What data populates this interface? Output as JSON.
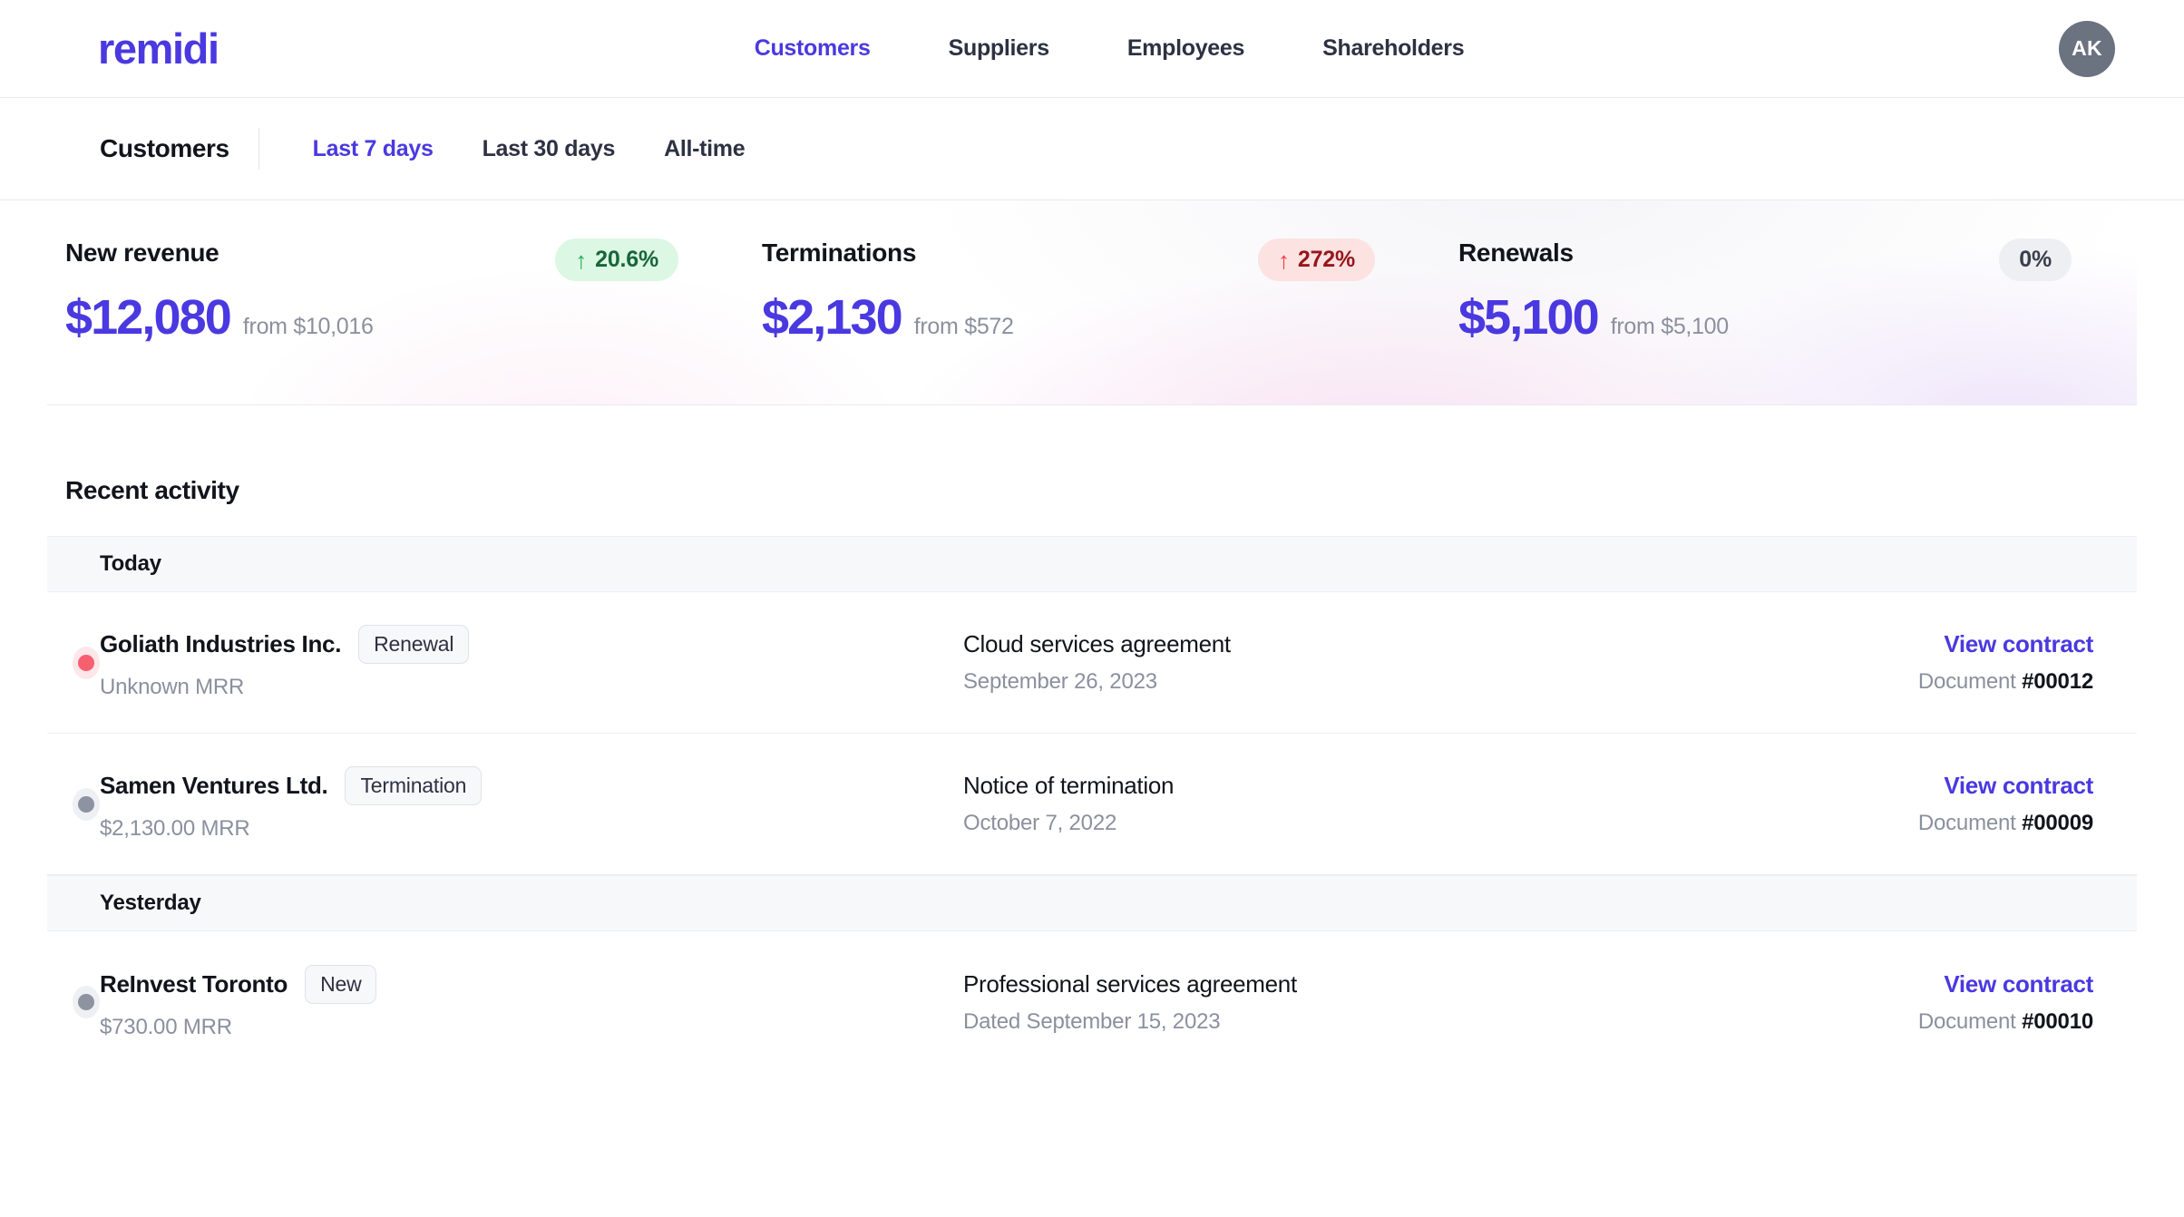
{
  "brand": {
    "logo_text": "remidi"
  },
  "topnav": {
    "items": [
      {
        "label": "Customers",
        "active": true
      },
      {
        "label": "Suppliers",
        "active": false
      },
      {
        "label": "Employees",
        "active": false
      },
      {
        "label": "Shareholders",
        "active": false
      }
    ],
    "avatar_initials": "AK"
  },
  "subheader": {
    "title": "Customers",
    "range_tabs": [
      {
        "label": "Last 7 days",
        "active": true
      },
      {
        "label": "Last 30 days",
        "active": false
      },
      {
        "label": "All-time",
        "active": false
      }
    ]
  },
  "metrics": [
    {
      "label": "New revenue",
      "amount": "$12,080",
      "from": "from $10,016",
      "badge": {
        "text": "20.6%",
        "arrow": "↑",
        "direction": "up"
      }
    },
    {
      "label": "Terminations",
      "amount": "$2,130",
      "from": "from $572",
      "badge": {
        "text": "272%",
        "arrow": "↑",
        "direction": "down"
      }
    },
    {
      "label": "Renewals",
      "amount": "$5,100",
      "from": "from $5,100",
      "badge": {
        "text": "0%",
        "arrow": "",
        "direction": "flat"
      }
    }
  ],
  "activity": {
    "title": "Recent activity",
    "groups": [
      {
        "label": "Today",
        "rows": [
          {
            "dot_color": "red",
            "entity": "Goliath Industries Inc.",
            "tag": "Renewal",
            "mrr": "Unknown MRR",
            "doc_title": "Cloud services agreement",
            "doc_date": "September 26, 2023",
            "action": "View contract",
            "doc_label": "Document",
            "doc_number": "#00012"
          },
          {
            "dot_color": "grey",
            "entity": "Samen Ventures Ltd.",
            "tag": "Termination",
            "mrr": "$2,130.00 MRR",
            "doc_title": "Notice of termination",
            "doc_date": "October 7, 2022",
            "action": "View contract",
            "doc_label": "Document",
            "doc_number": "#00009"
          }
        ]
      },
      {
        "label": "Yesterday",
        "rows": [
          {
            "dot_color": "grey",
            "entity": "ReInvest Toronto",
            "tag": "New",
            "mrr": "$730.00 MRR",
            "doc_title": "Professional services agreement",
            "doc_date": "Dated September 15, 2023",
            "action": "View contract",
            "doc_label": "Document",
            "doc_number": "#00010"
          }
        ]
      }
    ]
  },
  "colors": {
    "accent": "#4a39e0",
    "up": "#17663a",
    "down": "#96171c",
    "dot_red": "#f8606f",
    "dot_grey": "#8d93a1",
    "avatar_bg": "#6b7280"
  }
}
